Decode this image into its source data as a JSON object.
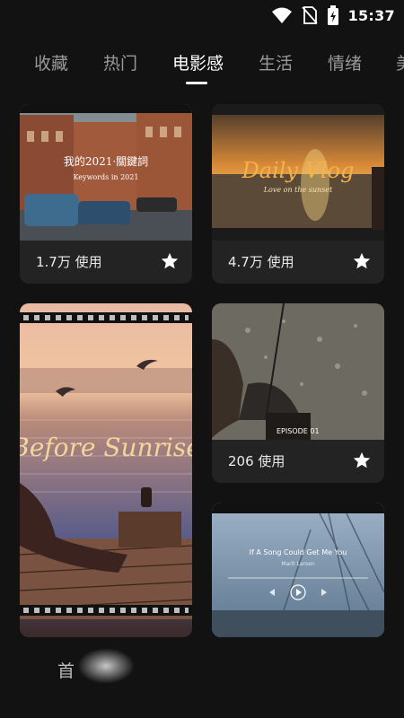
{
  "status_bar": {
    "time": "15:37",
    "icons": [
      "wifi-icon",
      "no-sim-icon",
      "battery-charging-icon"
    ]
  },
  "tabs": [
    {
      "label": "收藏",
      "active": false
    },
    {
      "label": "热门",
      "active": false
    },
    {
      "label": "电影感",
      "active": true
    },
    {
      "label": "生活",
      "active": false
    },
    {
      "label": "情绪",
      "active": false
    },
    {
      "label": "美",
      "active": false
    }
  ],
  "cards": [
    {
      "id": "card1",
      "usage": "1.7万 使用",
      "thumb_title": "我的2021·關鍵詞",
      "thumb_subtitle": "Keywords in 2021"
    },
    {
      "id": "card2",
      "usage": "4.7万 使用",
      "thumb_title": "Daily Vlog",
      "thumb_subtitle": "Love on the sunset"
    },
    {
      "id": "card3",
      "usage": "",
      "thumb_title": "Before Sunrise"
    },
    {
      "id": "card4",
      "usage": "206 使用",
      "thumb_title": "EPISODE 01"
    },
    {
      "id": "card5",
      "usage": "",
      "thumb_title": "If A Song Could Get Me You",
      "thumb_subtitle": "Marit Larsen"
    }
  ],
  "bottom_nav": {
    "home_label": "首"
  },
  "colors": {
    "background": "#121212",
    "card": "#232323",
    "inactive_tab": "#9a9a9a",
    "active_tab": "#ffffff"
  }
}
